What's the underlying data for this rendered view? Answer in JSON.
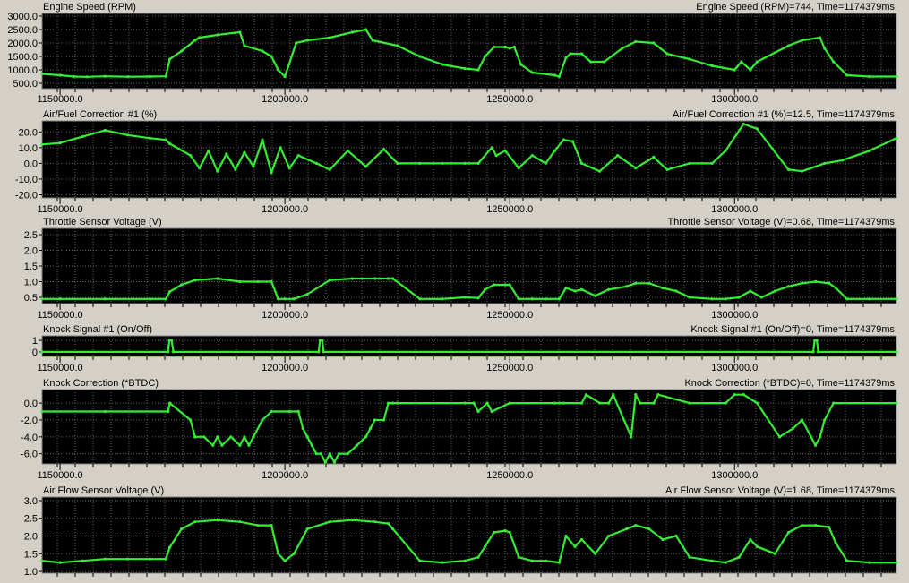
{
  "colors": {
    "background": "#d4d0c8",
    "plot": "#000000",
    "trace": "#33ee33",
    "grid": "#666666"
  },
  "chart_data": [
    {
      "type": "line",
      "title": "Engine Speed (RPM)",
      "readout": "Engine Speed (RPM)=744, Time=1174379ms",
      "ylim": [
        300,
        3100
      ],
      "yticks": [
        500,
        1000,
        1500,
        2000,
        2500,
        3000
      ],
      "ytick_labels": [
        "500.0",
        "1000.0",
        "1500.0",
        "2000.0",
        "2500.0",
        "3000.0"
      ],
      "x": [
        1146000,
        1150000,
        1153000,
        1156000,
        1160000,
        1165000,
        1170000,
        1173500,
        1174400,
        1177000,
        1180000,
        1181000,
        1185000,
        1190000,
        1191000,
        1195000,
        1197000,
        1198500,
        1200000,
        1202500,
        1205000,
        1210000,
        1215000,
        1218000,
        1219500,
        1225000,
        1230000,
        1235000,
        1240000,
        1243000,
        1244500,
        1246500,
        1249000,
        1250000,
        1251000,
        1252500,
        1255000,
        1260000,
        1261000,
        1262500,
        1263500,
        1266000,
        1268000,
        1271000,
        1275000,
        1278000,
        1282000,
        1285000,
        1290000,
        1295000,
        1300000,
        1301500,
        1303500,
        1305000,
        1312000,
        1315000,
        1319000,
        1320000,
        1322000,
        1325000,
        1330000,
        1336000
      ],
      "values": [
        850,
        800,
        750,
        740,
        760,
        744,
        750,
        760,
        1400,
        1700,
        2100,
        2200,
        2300,
        2400,
        1900,
        1700,
        1500,
        1000,
        750,
        2000,
        2100,
        2200,
        2400,
        2500,
        2100,
        1900,
        1500,
        1200,
        1050,
        1000,
        1500,
        1850,
        1850,
        1800,
        1850,
        1200,
        900,
        800,
        750,
        1450,
        1600,
        1600,
        1300,
        1300,
        1800,
        2050,
        2000,
        1600,
        1400,
        1150,
        1000,
        1300,
        1000,
        1300,
        1900,
        2100,
        2200,
        1800,
        1300,
        800,
        750,
        750
      ],
      "x_series_ms": true,
      "xlim": [
        1146000,
        1336000
      ],
      "xticks": [
        1150000,
        1200000,
        1250000,
        1300000
      ],
      "xtick_labels": [
        "1150000.0",
        "1200000.0",
        "1250000.0",
        "1300000.0"
      ]
    },
    {
      "type": "line",
      "title": "Air/Fuel Correction #1 (%)",
      "readout": "Air/Fuel Correction #1 (%)=12.5, Time=1174379ms",
      "ylim": [
        -22,
        27
      ],
      "yticks": [
        -20,
        -10,
        0,
        10,
        20
      ],
      "ytick_labels": [
        "-20.0",
        "-10.0",
        "0.0",
        "10.0",
        "20.0"
      ],
      "x": [
        1146000,
        1150000,
        1155000,
        1160000,
        1165000,
        1170000,
        1173500,
        1174400,
        1179000,
        1181000,
        1183000,
        1185000,
        1187000,
        1189000,
        1191000,
        1193000,
        1195000,
        1197000,
        1199000,
        1201000,
        1203000,
        1207000,
        1210000,
        1214000,
        1218000,
        1222000,
        1225000,
        1230000,
        1235000,
        1240000,
        1243000,
        1246000,
        1247000,
        1249000,
        1252000,
        1255000,
        1258000,
        1260000,
        1262000,
        1264000,
        1266000,
        1270000,
        1274000,
        1278000,
        1282000,
        1285000,
        1290000,
        1295000,
        1298000,
        1302000,
        1305000,
        1312000,
        1315000,
        1320000,
        1324000,
        1330000,
        1336000
      ],
      "values": [
        12,
        13,
        17,
        21,
        18,
        16,
        15,
        12.5,
        5,
        -3,
        8,
        -5,
        6,
        -4,
        7,
        -2,
        15,
        -6,
        10,
        -3,
        5,
        0,
        -4,
        8,
        -2,
        9,
        0,
        0,
        0,
        0,
        0,
        10,
        5,
        8,
        -3,
        5,
        0,
        8,
        15,
        14,
        0,
        -5,
        5,
        -3,
        4,
        -4,
        0,
        0,
        8,
        25,
        22,
        -4,
        -5,
        0,
        2,
        8,
        16
      ],
      "xlim": [
        1146000,
        1336000
      ],
      "xticks": [
        1150000,
        1200000,
        1250000,
        1300000
      ],
      "xtick_labels": [
        "1150000.0",
        "1200000.0",
        "1250000.0",
        "1300000.0"
      ]
    },
    {
      "type": "line",
      "title": "Throttle Sensor Voltage (V)",
      "readout": "Throttle Sensor Voltage (V)=0.68, Time=1174379ms",
      "ylim": [
        0.3,
        2.7
      ],
      "yticks": [
        0.5,
        1.0,
        1.5,
        2.0,
        2.5
      ],
      "ytick_labels": [
        "0.5",
        "1.0",
        "1.5",
        "2.0",
        "2.5"
      ],
      "x": [
        1146000,
        1150000,
        1160000,
        1170000,
        1173500,
        1174400,
        1177000,
        1180000,
        1185000,
        1190000,
        1194000,
        1197000,
        1198500,
        1200000,
        1202000,
        1205000,
        1210000,
        1215000,
        1220000,
        1223000,
        1224000,
        1230000,
        1235000,
        1240000,
        1243000,
        1244500,
        1246500,
        1249000,
        1250000,
        1252000,
        1255000,
        1258000,
        1261000,
        1262500,
        1264500,
        1266000,
        1269000,
        1272000,
        1276000,
        1278000,
        1281000,
        1284000,
        1287000,
        1290000,
        1295000,
        1298000,
        1301000,
        1303500,
        1306000,
        1309000,
        1312000,
        1315000,
        1318000,
        1321000,
        1322500,
        1325000,
        1330000,
        1336000
      ],
      "values": [
        0.45,
        0.45,
        0.45,
        0.45,
        0.45,
        0.68,
        0.9,
        1.05,
        1.1,
        1.0,
        1.0,
        1.0,
        0.45,
        0.45,
        0.45,
        0.6,
        1.05,
        1.1,
        1.1,
        1.1,
        1.1,
        0.45,
        0.45,
        0.5,
        0.48,
        0.75,
        0.9,
        0.9,
        0.9,
        0.45,
        0.45,
        0.45,
        0.45,
        0.8,
        0.7,
        0.75,
        0.55,
        0.75,
        0.85,
        0.95,
        0.95,
        0.8,
        0.7,
        0.5,
        0.45,
        0.45,
        0.5,
        0.7,
        0.5,
        0.7,
        0.85,
        0.95,
        1.0,
        0.95,
        0.8,
        0.45,
        0.45,
        0.45
      ],
      "xlim": [
        1146000,
        1336000
      ],
      "xticks": [
        1150000,
        1200000,
        1250000,
        1300000
      ],
      "xtick_labels": [
        "1150000.0",
        "1200000.0",
        "1250000.0",
        "1300000.0"
      ]
    },
    {
      "type": "line",
      "title": "Knock Signal #1 (On/Off)",
      "readout": "Knock Signal #1 (On/Off)=0, Time=1174379ms",
      "ylim": [
        -0.4,
        1.4
      ],
      "yticks": [
        0,
        1
      ],
      "ytick_labels": [
        "0",
        "1"
      ],
      "x": [
        1146000,
        1174000,
        1174300,
        1174800,
        1175200,
        1207500,
        1207800,
        1208300,
        1208600,
        1317500,
        1317800,
        1318300,
        1318600,
        1336000
      ],
      "values": [
        0,
        0,
        1,
        1,
        0,
        0,
        1,
        1,
        0,
        0,
        1,
        1,
        0,
        0
      ],
      "xlim": [
        1146000,
        1336000
      ],
      "xticks": [
        1150000,
        1200000,
        1250000,
        1300000
      ],
      "xtick_labels": [
        "1150000.0",
        "1200000.0",
        "1250000.0",
        "1300000.0"
      ]
    },
    {
      "type": "line",
      "title": "Knock Correction (*BTDC)",
      "readout": "Knock Correction (*BTDC)=0, Time=1174379ms",
      "ylim": [
        -7.2,
        1.6
      ],
      "yticks": [
        -6,
        -4,
        -2,
        0
      ],
      "ytick_labels": [
        "-6.0",
        "-4.0",
        "-2.0",
        "0.0"
      ],
      "x": [
        1146000,
        1160000,
        1174000,
        1174400,
        1179000,
        1180000,
        1182000,
        1184000,
        1185000,
        1186000,
        1188000,
        1190000,
        1191000,
        1192000,
        1193000,
        1195000,
        1197000,
        1201000,
        1203000,
        1204000,
        1205000,
        1206000,
        1207000,
        1208000,
        1209000,
        1210000,
        1211000,
        1212000,
        1214000,
        1216000,
        1218000,
        1219000,
        1220000,
        1222000,
        1223000,
        1224000,
        1225000,
        1240000,
        1242000,
        1243000,
        1245000,
        1246000,
        1250000,
        1260000,
        1261000,
        1262000,
        1266000,
        1267000,
        1270000,
        1272000,
        1273000,
        1277000,
        1278000,
        1279000,
        1282000,
        1283000,
        1290000,
        1298000,
        1300000,
        1302000,
        1305000,
        1310000,
        1313000,
        1315000,
        1317000,
        1318000,
        1319000,
        1320000,
        1322000,
        1336000
      ],
      "values": [
        -1,
        -1,
        -1,
        0,
        -2,
        -4,
        -4,
        -5,
        -4,
        -5,
        -4,
        -5,
        -4,
        -5,
        -4,
        -2,
        -1,
        -1,
        -1,
        -3,
        -4,
        -5,
        -6,
        -6,
        -7,
        -6,
        -7,
        -6,
        -6,
        -5,
        -4,
        -3,
        -2,
        -2,
        0,
        0,
        0,
        0,
        0,
        -1,
        0,
        -1,
        0,
        0,
        0,
        0,
        0,
        1,
        0,
        0,
        1,
        -4,
        1,
        0,
        0,
        1,
        0,
        0,
        1,
        1,
        0,
        -4,
        -3,
        -2,
        -4,
        -5,
        -4,
        -2,
        0,
        0
      ],
      "xlim": [
        1146000,
        1336000
      ],
      "xticks": [
        1150000,
        1200000,
        1250000,
        1300000
      ],
      "xtick_labels": [
        "1150000.0",
        "1200000.0",
        "1250000.0",
        "1300000.0"
      ]
    },
    {
      "type": "line",
      "title": "Air Flow Sensor Voltage (V)",
      "readout": "Air Flow Sensor Voltage (V)=1.68, Time=1174379ms",
      "ylim": [
        0.95,
        3.1
      ],
      "yticks": [
        1.0,
        1.5,
        2.0,
        2.5,
        3.0
      ],
      "ytick_labels": [
        "1.0",
        "1.5",
        "2.0",
        "2.5",
        "3.0"
      ],
      "x": [
        1146000,
        1150000,
        1155000,
        1160000,
        1165000,
        1170000,
        1173500,
        1174400,
        1177000,
        1180000,
        1185000,
        1190000,
        1194000,
        1197000,
        1198500,
        1200000,
        1202000,
        1205000,
        1210000,
        1215000,
        1220000,
        1223000,
        1224000,
        1230000,
        1235000,
        1240000,
        1243000,
        1244500,
        1246500,
        1249000,
        1250000,
        1252000,
        1255000,
        1258000,
        1261000,
        1262500,
        1264500,
        1266000,
        1269000,
        1272000,
        1276000,
        1278000,
        1281000,
        1284000,
        1287000,
        1290000,
        1295000,
        1298000,
        1301000,
        1303500,
        1305000,
        1309000,
        1312000,
        1315000,
        1318000,
        1321000,
        1322500,
        1325000,
        1330000,
        1336000
      ],
      "values": [
        1.3,
        1.25,
        1.3,
        1.35,
        1.35,
        1.35,
        1.35,
        1.68,
        2.2,
        2.4,
        2.45,
        2.4,
        2.3,
        2.3,
        1.5,
        1.3,
        1.5,
        2.2,
        2.4,
        2.45,
        2.4,
        2.35,
        2.2,
        1.3,
        1.25,
        1.3,
        1.4,
        1.7,
        2.1,
        2.15,
        2.1,
        1.4,
        1.3,
        1.3,
        1.25,
        2.0,
        1.7,
        1.9,
        1.5,
        2.0,
        2.2,
        2.3,
        2.2,
        1.9,
        2.0,
        1.4,
        1.3,
        1.25,
        1.4,
        1.9,
        1.7,
        1.5,
        2.1,
        2.3,
        2.3,
        2.25,
        1.8,
        1.3,
        1.25,
        1.25
      ],
      "xlim": [
        1146000,
        1336000
      ],
      "xticks": [
        1150000,
        1200000,
        1250000,
        1300000
      ],
      "xtick_labels": [
        "1150000.0",
        "1200000.0",
        "1250000.0",
        "1300000.0"
      ]
    }
  ]
}
